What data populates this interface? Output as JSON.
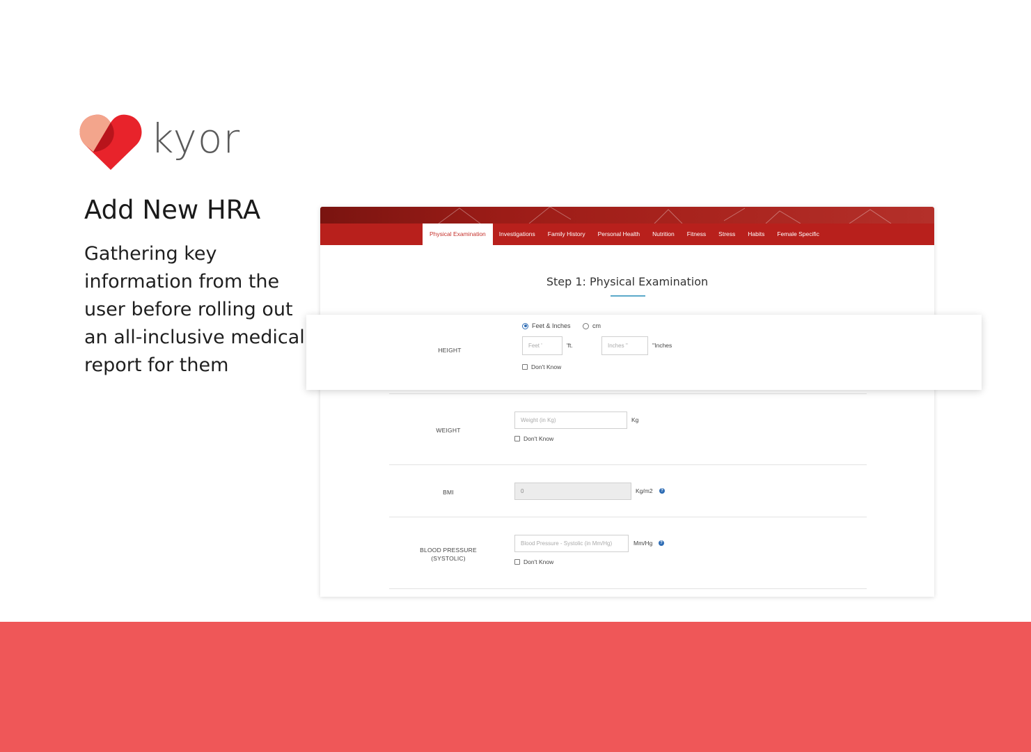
{
  "brand": {
    "name": "kyor",
    "heart_colors": [
      "#f3a58c",
      "#e8232b",
      "#b8141b"
    ]
  },
  "headline": "Add New HRA",
  "subtext": "Gathering key information from the user before rolling out an all-inclusive medical report for them",
  "app": {
    "tabs": [
      {
        "label": "Physical Examination",
        "active": true
      },
      {
        "label": "Investigations"
      },
      {
        "label": "Family History"
      },
      {
        "label": "Personal Health"
      },
      {
        "label": "Nutrition"
      },
      {
        "label": "Fitness"
      },
      {
        "label": "Stress"
      },
      {
        "label": "Habits"
      },
      {
        "label": "Female Specific"
      }
    ],
    "step_title": "Step 1: Physical Examination",
    "height": {
      "label": "HEIGHT",
      "unit_options": [
        {
          "label": "Feet & Inches",
          "selected": true
        },
        {
          "label": "cm",
          "selected": false
        }
      ],
      "feet_placeholder": "Feet '",
      "feet_unit": "'ft.",
      "inches_placeholder": "Inches ''",
      "inches_unit": "''Inches",
      "dont_know": "Don't Know"
    },
    "weight": {
      "label": "WEIGHT",
      "placeholder": "Weight (in Kg)",
      "unit": "Kg",
      "dont_know": "Don't Know"
    },
    "bmi": {
      "label": "BMI",
      "value": "0",
      "unit": "Kg/m2"
    },
    "bp": {
      "label_line1": "BLOOD PRESSURE",
      "label_line2": "(SYSTOLIC)",
      "placeholder": "Blood Pressure - Systolic (in Mm/Hg)",
      "unit": "Mm/Hg",
      "dont_know": "Don't Know"
    }
  },
  "colors": {
    "accent_red": "#b8201c",
    "footer": "#ef5758",
    "underline": "#5aa9c9",
    "help": "#2f6db5"
  }
}
